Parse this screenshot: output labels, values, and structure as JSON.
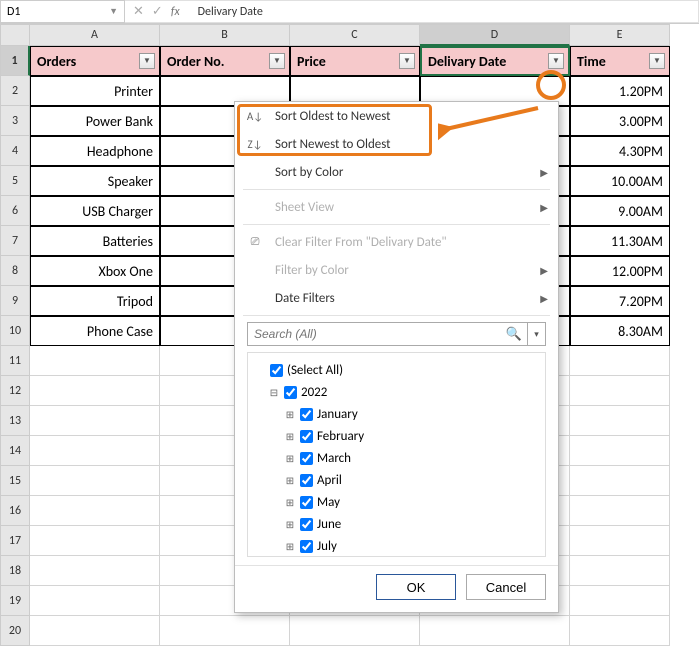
{
  "namebox": {
    "ref": "D1"
  },
  "formula_bar": {
    "value": "Delivary Date"
  },
  "columns": [
    "A",
    "B",
    "C",
    "D",
    "E"
  ],
  "headers": {
    "A": "Orders",
    "B": "Order No.",
    "C": "Price",
    "D": "Delivary Date",
    "E": "Time"
  },
  "rows": [
    {
      "A": "Printer",
      "E": "1.20PM"
    },
    {
      "A": "Power Bank",
      "E": "3.00PM"
    },
    {
      "A": "Headphone",
      "E": "4.30PM"
    },
    {
      "A": "Speaker",
      "E": "10.00AM"
    },
    {
      "A": "USB Charger",
      "E": "9.00AM"
    },
    {
      "A": "Batteries",
      "E": "11.30AM"
    },
    {
      "A": "Xbox One",
      "E": "12.00PM"
    },
    {
      "A": "Tripod",
      "E": "7.20PM"
    },
    {
      "A": "Phone Case",
      "E": "8.30AM"
    }
  ],
  "row_numbers": [
    "1",
    "2",
    "3",
    "4",
    "5",
    "6",
    "7",
    "8",
    "9",
    "10",
    "11",
    "12",
    "13",
    "14",
    "15",
    "16",
    "17",
    "18",
    "19",
    "20"
  ],
  "menu": {
    "sort_asc": "Sort Oldest to Newest",
    "sort_desc": "Sort Newest to Oldest",
    "sort_color": "Sort by Color",
    "sheet_view": "Sheet View",
    "clear_filter": "Clear Filter From \"Delivary Date\"",
    "filter_color": "Filter by Color",
    "date_filters": "Date Filters",
    "search_placeholder": "Search (All)",
    "select_all": "(Select All)",
    "year": "2022",
    "months": [
      "January",
      "February",
      "March",
      "April",
      "May",
      "June",
      "July"
    ],
    "ok": "OK",
    "cancel": "Cancel"
  }
}
